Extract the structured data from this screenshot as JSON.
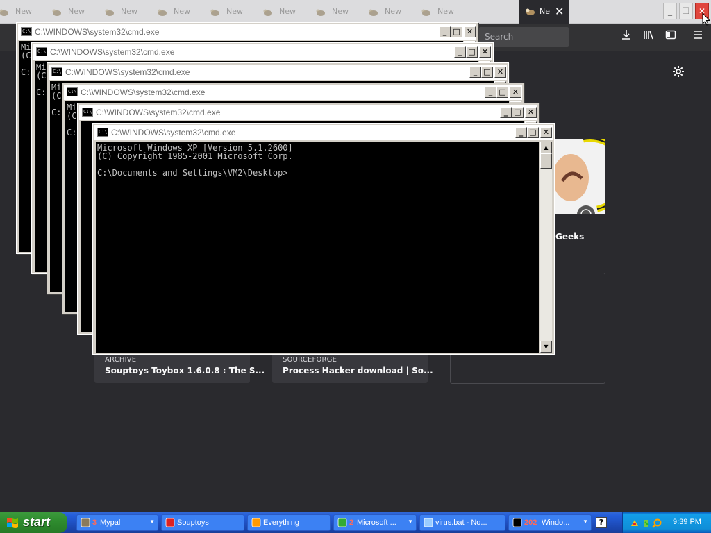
{
  "browser": {
    "tab_label": "Ne",
    "background_tab_label": "New",
    "background_tab_count": 9,
    "search_placeholder": "Search",
    "icons": {
      "downloads": "download-icon",
      "library": "library-icon",
      "sidebar": "sidebar-icon",
      "menu": "hamburger-menu-icon",
      "settings": "gear-icon"
    },
    "close_symbol": "✕",
    "window_buttons": {
      "minimize": "_",
      "restore": "❐",
      "close": "✕"
    }
  },
  "new_tab": {
    "top_sites_label": "Geeks",
    "highlights": [
      {
        "source": "ARCHIVE",
        "title": "Souptoys Toybox 1.6.0.8 : The S..."
      },
      {
        "source": "SOURCEFORGE",
        "title": "Process Hacker download | So..."
      }
    ]
  },
  "cmd_windows": {
    "title": "C:\\WINDOWS\\system32\\cmd.exe",
    "console_line1": "Microsoft Windows XP [Version 5.1.2600]",
    "console_line2": "(C) Copyright 1985-2001 Microsoft Corp.",
    "prompt": "C:\\Documents and Settings\\VM2\\Desktop>",
    "hidden_fragments": {
      "ms": "Mi",
      "copy": "(C",
      "prompt": "C:\\",
      "prompt_do": "C:\\Do"
    },
    "buttons": {
      "minimize": "_",
      "maximize": "□",
      "close": "✕"
    }
  },
  "taskbar": {
    "start_label": "start",
    "items": [
      {
        "count": "3",
        "label": "Mypal",
        "icon": "mypal-icon"
      },
      {
        "count": "",
        "label": "Souptoys",
        "icon": "souptoys-icon"
      },
      {
        "count": "",
        "label": "Everything",
        "icon": "everything-search-icon"
      },
      {
        "count": "2",
        "label": "Microsoft ...",
        "icon": "microsoft-icon"
      },
      {
        "count": "",
        "label": "virus.bat - No...",
        "icon": "notepad-icon"
      },
      {
        "count": "202",
        "label": "Windo...",
        "icon": "cmd-icon"
      }
    ],
    "help_symbol": "?",
    "clock": "9:39 PM"
  }
}
